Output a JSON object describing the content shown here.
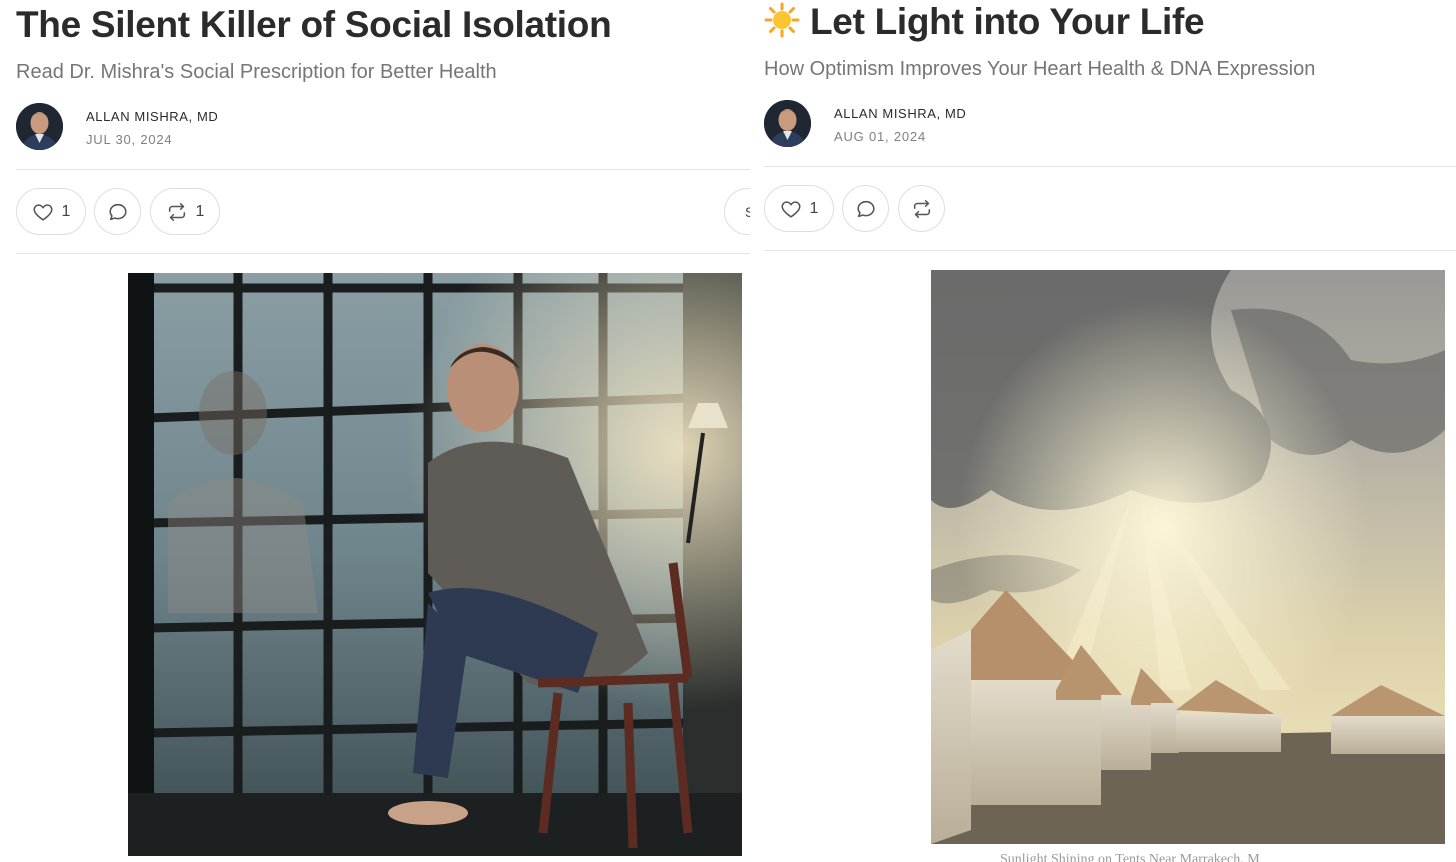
{
  "posts": [
    {
      "title": "The Silent Killer of Social Isolation",
      "subtitle": "Read Dr. Mishra's Social Prescription for Better Health",
      "author": "ALLAN MISHRA, MD",
      "date": "JUL 30, 2024",
      "actions": {
        "like_count": "1",
        "restack_count": "1",
        "share_label": "S"
      },
      "image_icon": "man-by-rainy-window-image"
    },
    {
      "title_emoji_icon": "sun-icon",
      "title": "Let Light into Your Life",
      "subtitle": "How Optimism Improves Your Heart Health & DNA Expression",
      "author": "ALLAN MISHRA, MD",
      "date": "AUG 01, 2024",
      "actions": {
        "like_count": "1"
      },
      "image_icon": "sunlight-over-tents-image",
      "caption": "Sunlight Shining on Tents Near Marrakech, M"
    }
  ],
  "colors": {
    "title": "#2b2b2b",
    "subtitle": "#767676",
    "date": "#808080",
    "divider": "#e4e4e4",
    "pill_border": "#dedede"
  }
}
